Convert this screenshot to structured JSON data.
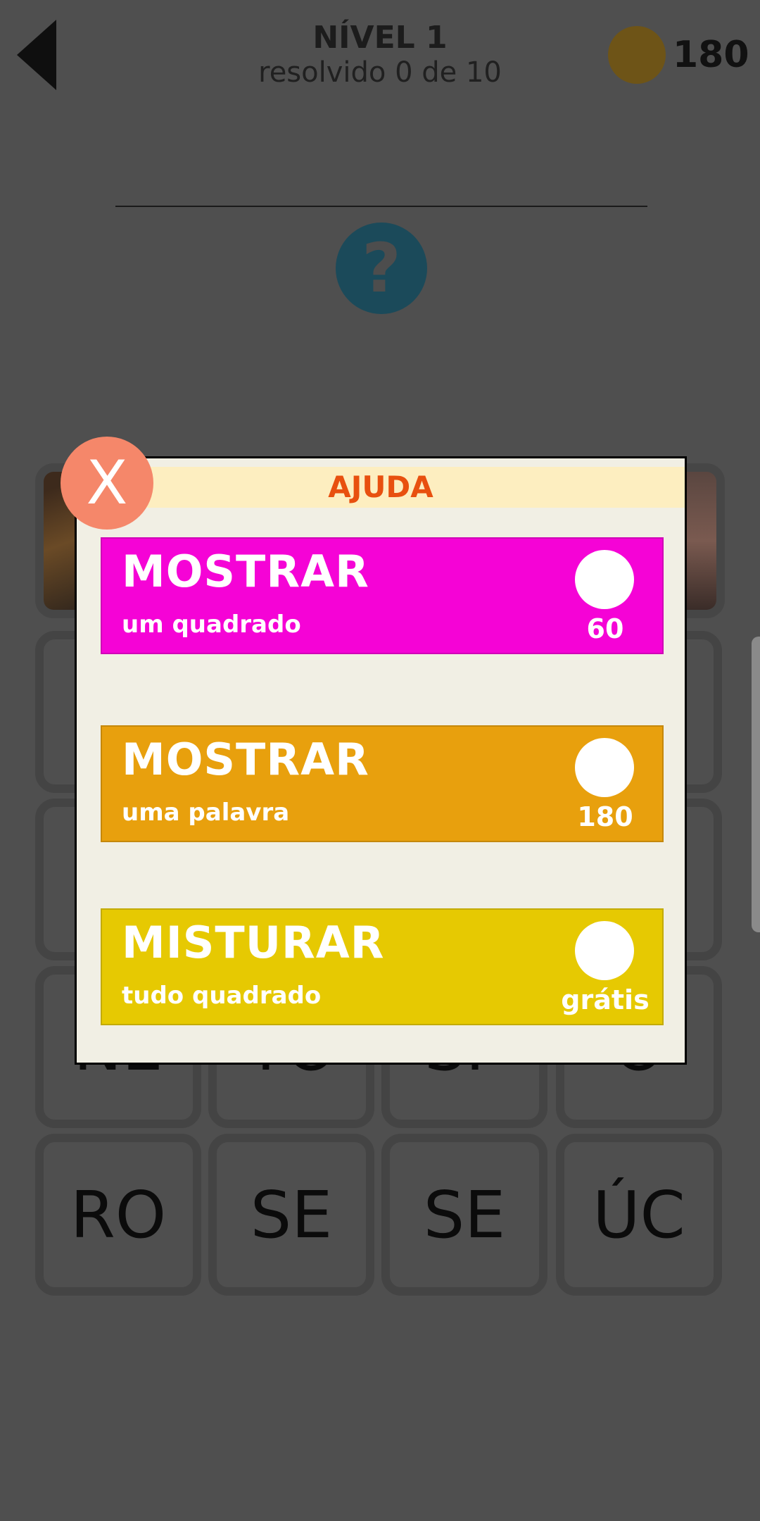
{
  "header": {
    "level_title": "NÍVEL 1",
    "progress_text": "resolvido 0 de 10",
    "coins": "180"
  },
  "hint_symbol": "?",
  "tiles_row4": [
    "NE",
    "TO",
    "SP",
    "O"
  ],
  "tiles_row5": [
    "RO",
    "SE",
    "SE",
    "ÚC"
  ],
  "dialog": {
    "title": "AJUDA",
    "close_label": "X",
    "options": [
      {
        "action": "MOSTRAR",
        "detail": "um quadrado",
        "price": "60",
        "color": "#f503d6"
      },
      {
        "action": "MOSTRAR",
        "detail": "uma palavra",
        "price": "180",
        "color": "#e8a00d"
      },
      {
        "action": "MISTURAR",
        "detail": "tudo quadrado",
        "price": "grátis",
        "color": "#e6c902"
      }
    ]
  },
  "colors": {
    "overlay_bg": "#4f4f4f",
    "dialog_bg": "#f1efe4",
    "dialog_header_bg": "#fdeec0",
    "dialog_title": "#e8500f",
    "close_button": "#f5876a"
  }
}
